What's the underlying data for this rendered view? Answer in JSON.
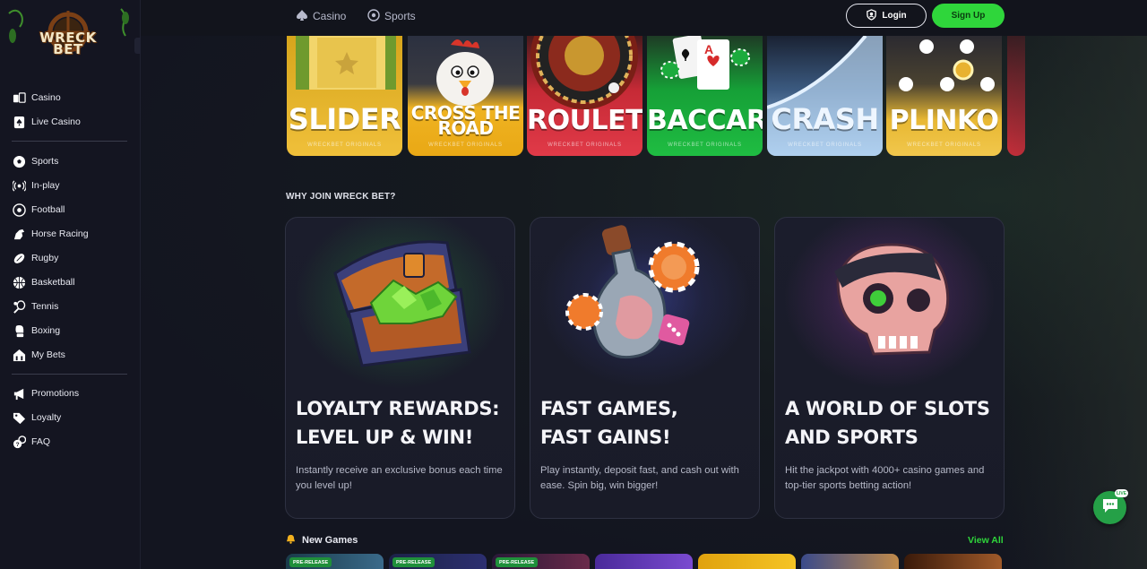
{
  "brand": {
    "logo_text_line1": "WRECK",
    "logo_text_line2": "BET"
  },
  "sidebar": {
    "collapse_icon": "chevron-left-icon",
    "groups": [
      [
        {
          "label": "Casino",
          "icon": "casino-icon"
        },
        {
          "label": "Live Casino",
          "icon": "spade-card-icon"
        }
      ],
      [
        {
          "label": "Sports",
          "icon": "soccer-ball-icon"
        },
        {
          "label": "In-play",
          "icon": "broadcast-icon"
        },
        {
          "label": "Football",
          "icon": "football-icon"
        },
        {
          "label": "Horse Racing",
          "icon": "horse-icon"
        },
        {
          "label": "Rugby",
          "icon": "rugby-ball-icon"
        },
        {
          "label": "Basketball",
          "icon": "basketball-icon"
        },
        {
          "label": "Tennis",
          "icon": "tennis-icon"
        },
        {
          "label": "Boxing",
          "icon": "boxing-glove-icon"
        },
        {
          "label": "My Bets",
          "icon": "my-bets-icon"
        }
      ],
      [
        {
          "label": "Promotions",
          "icon": "megaphone-icon"
        },
        {
          "label": "Loyalty",
          "icon": "loyalty-tag-icon"
        },
        {
          "label": "FAQ",
          "icon": "faq-icon"
        }
      ]
    ]
  },
  "topbar": {
    "tabs": [
      {
        "label": "Casino",
        "icon": "spade-icon"
      },
      {
        "label": "Sports",
        "icon": "sports-ball-icon"
      }
    ],
    "login_label": "Login",
    "signup_label": "Sign Up",
    "colors": {
      "signup_bg": "#2fd63b"
    }
  },
  "games": [
    {
      "title": "SLIDER",
      "subtitle": "WRECKBET ORIGINALS",
      "color": "#e9b21c"
    },
    {
      "title": "CROSS THE ROAD",
      "subtitle": "WRECKBET ORIGINALS",
      "color": "#efb322"
    },
    {
      "title": "ROULETTE",
      "subtitle": "WRECKBET ORIGINALS",
      "color": "#d9303e"
    },
    {
      "title": "BACCARAT",
      "subtitle": "WRECKBET ORIGINALS",
      "color": "#1fa83a"
    },
    {
      "title": "CRASH",
      "subtitle": "WRECKBET ORIGINALS",
      "color": "#9fc4e6"
    },
    {
      "title": "PLINKO",
      "subtitle": "WRECKBET ORIGINALS",
      "color": "#e8b833"
    }
  ],
  "why": {
    "title": "WHY JOIN WRECK BET?",
    "cards": [
      {
        "heading_line1": "LOYALTY REWARDS:",
        "heading_line2": "LEVEL UP & WIN!",
        "description": "Instantly receive an exclusive bonus each time you level up!",
        "art": "treasure-chest"
      },
      {
        "heading_line1": "FAST GAMES,",
        "heading_line2": "FAST GAINS!",
        "description": "Play instantly, deposit fast, and cash out with ease. Spin big, win bigger!",
        "art": "potion-bottle-chips"
      },
      {
        "heading_line1": "A WORLD OF SLOTS",
        "heading_line2": "AND SPORTS",
        "description": "Hit the jackpot with 4000+ casino games and top-tier sports betting action!",
        "art": "pirate-skull"
      }
    ]
  },
  "new_games": {
    "title": "New Games",
    "icon": "bell-icon",
    "view_all_label": "View All",
    "badge_label": "PRE-RELEASE"
  },
  "chat": {
    "icon": "chat-bubble-icon",
    "badge": "LIVE"
  }
}
